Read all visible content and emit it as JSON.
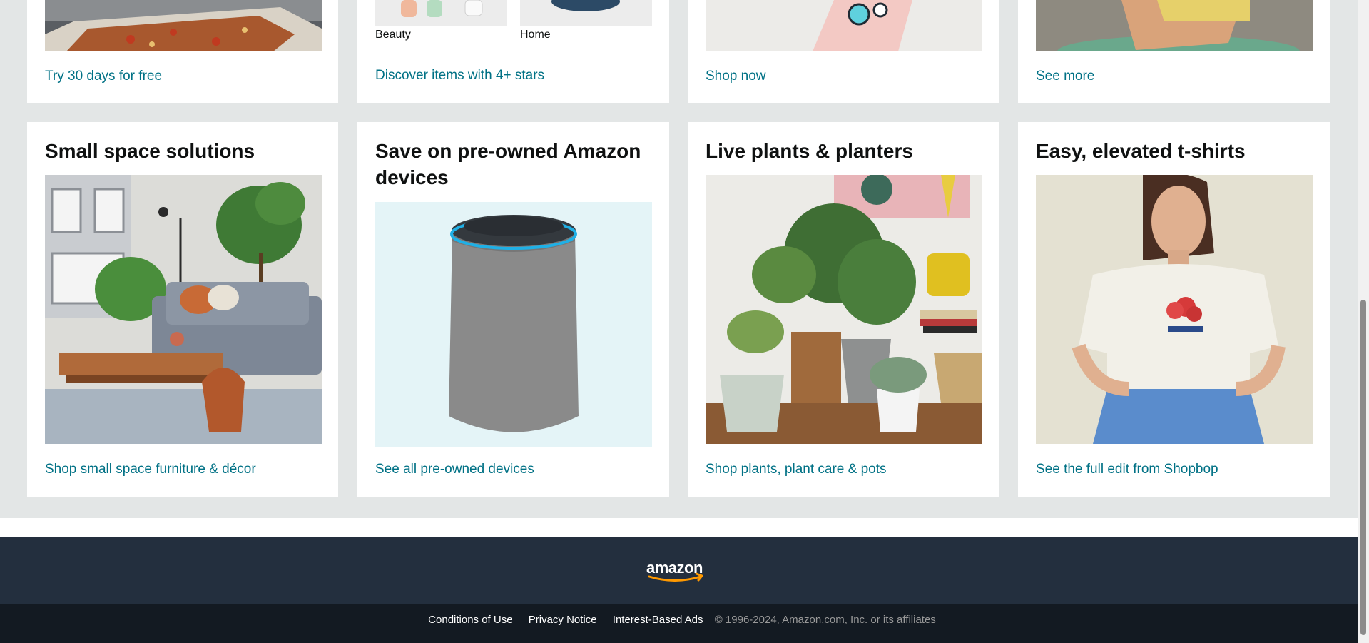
{
  "top_row": {
    "prime_link": "Try 30 days for free",
    "beauty_label": "Beauty",
    "home_label": "Home",
    "stars_link": "Discover items with 4+ stars",
    "shop_now_link": "Shop now",
    "see_more_link": "See more"
  },
  "cards": [
    {
      "title": "Small space solutions",
      "link": "Shop small space furniture & décor"
    },
    {
      "title": "Save on pre-owned Amazon devices",
      "link": "See all pre-owned devices"
    },
    {
      "title": "Live plants & planters",
      "link": "Shop plants, plant care & pots"
    },
    {
      "title": "Easy, elevated t-shirts",
      "link": "See the full edit from Shopbop"
    }
  ],
  "footer": {
    "logo_text": "amazon",
    "links": [
      "Conditions of Use",
      "Privacy Notice",
      "Interest-Based Ads"
    ],
    "copyright": "© 1996-2024, Amazon.com, Inc. or its affiliates"
  },
  "colors": {
    "page_bg": "#e3e6e6",
    "link": "#007185",
    "footer_top": "#232f3e",
    "footer_bottom": "#131a22",
    "logo_smile": "#ff9900"
  }
}
